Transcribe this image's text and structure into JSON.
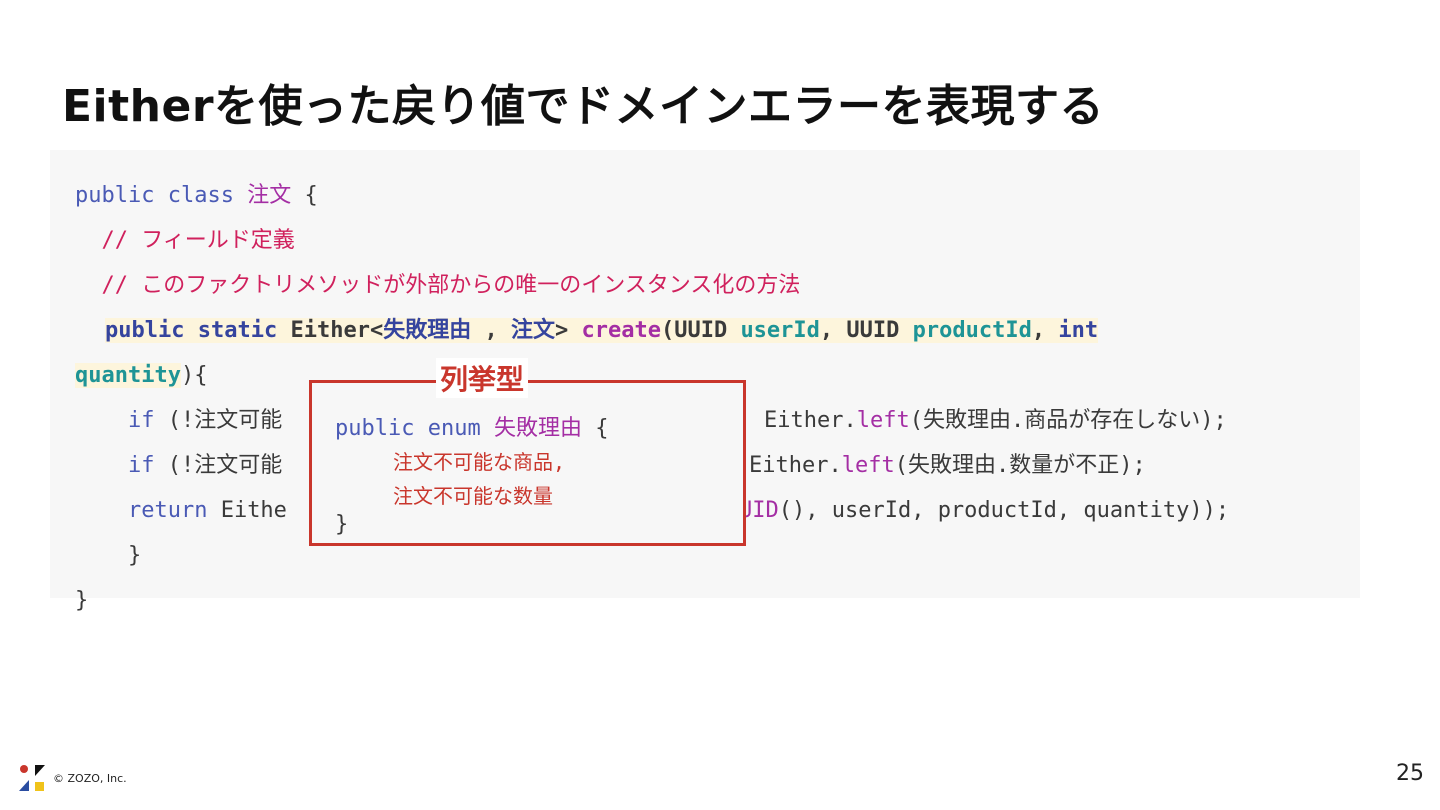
{
  "slide": {
    "title": "Eitherを使った戻り値でドメインエラーを表現する",
    "page_number": "25",
    "copyright": "© ZOZO, Inc."
  },
  "code": {
    "l1_public": "public",
    "l1_class": "class",
    "l1_name": "注文",
    "l1_brace": " {",
    "l2_comment": "  // フィールド定義",
    "l3_comment": "  // このファクトリメソッドが外部からの唯一のインスタンス化の方法",
    "l4_public": "public",
    "l4_static": "static",
    "l4_either": "Either<",
    "l4_type1": "失敗理由",
    "l4_comma": " , ",
    "l4_type2": "注文",
    "l4_gt": "> ",
    "l4_create": "create",
    "l4_paren": "(",
    "l4_uuid1": "UUID ",
    "l4_userId": "userId",
    "l4_sep": ", ",
    "l4_uuid2": "UUID ",
    "l4_productId": "productId",
    "l4_sep2": ", ",
    "l4_int": "int",
    "l5_quantity": "quantity",
    "l5_rest": "){",
    "l6_if": "    if",
    "l6_mid": " (!注文可能",
    "l6_tail_pre": "Either.",
    "l6_left": "left",
    "l6_tail": "(失敗理由.商品が存在しない);",
    "l7_if": "    if",
    "l7_mid": " (!注文可能",
    "l7_tail_pre": "Either.",
    "l7_left": "left",
    "l7_tail": "(失敗理由.数量が不正);",
    "l8_return": "    return",
    "l8_mid": " Eithe",
    "l8_uid": "UID",
    "l8_tail": "(), userId, productId, quantity));",
    "l9_brace": "    }",
    "l10_brace": "}"
  },
  "enum_callout": {
    "label": "列挙型",
    "public": "public",
    "enum": "enum",
    "name": "失敗理由",
    "open": " {",
    "item1": "注文不可能な商品,",
    "item2": "注文不可能な数量",
    "close": "}"
  },
  "colors": {
    "keyword": "#4a5ab5",
    "class_name": "#a42ea4",
    "comment": "#d0215d",
    "param": "#1e9496",
    "highlight": "#fdf5dc",
    "callout": "#c9362c"
  }
}
